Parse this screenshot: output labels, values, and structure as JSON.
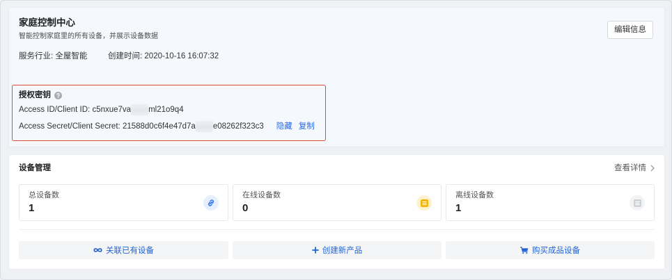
{
  "header": {
    "title": "家庭控制中心",
    "subtitle": "智能控制家庭里的所有设备，并展示设备数据",
    "industry_label": "服务行业:",
    "industry_value": "全屋智能",
    "created_label": "创建时间:",
    "created_value": "2020-10-16 16:07:32",
    "edit_button": "编辑信息"
  },
  "auth": {
    "title": "授权密钥",
    "help_icon": "question-circle-icon",
    "access_id_label": "Access ID/Client ID:",
    "access_id_prefix": "c5nxue7va",
    "access_id_suffix": "ml21o9q4",
    "secret_label": "Access Secret/Client Secret:",
    "secret_prefix": "21588d0c6f4e47d7a",
    "secret_suffix": "e08262f323c3",
    "hide_link": "隐藏",
    "copy_link": "复制"
  },
  "devices": {
    "title": "设备管理",
    "details_link": "查看详情",
    "details_icon": "chevron-right-icon",
    "stats": [
      {
        "label": "总设备数",
        "value": "1",
        "icon": "link-icon",
        "icon_color": "#3a78f0",
        "icon_bg": "#e6effd"
      },
      {
        "label": "在线设备数",
        "value": "0",
        "icon": "list-icon",
        "icon_color": "#f5b400",
        "icon_bg": "#fdf2cf"
      },
      {
        "label": "离线设备数",
        "value": "1",
        "icon": "list-icon",
        "icon_color": "#cfd2d7",
        "icon_bg": "#f2f3f5"
      }
    ],
    "actions": [
      {
        "label": "关联已有设备",
        "icon": "infinity-link-icon"
      },
      {
        "label": "创建新产品",
        "icon": "plus-icon"
      },
      {
        "label": "购买成品设备",
        "icon": "cart-icon"
      }
    ]
  },
  "theme": {
    "link_color": "#2b6be6",
    "action_color": "#1f64d6",
    "highlight_border": "#e04a3c",
    "card_background": "#f5f8fc"
  }
}
